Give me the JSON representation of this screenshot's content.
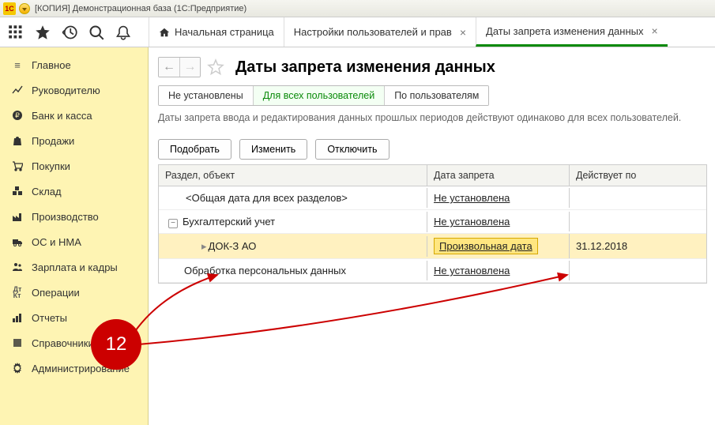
{
  "titlebar": {
    "text": "[КОПИЯ] Демонстрационная база  (1С:Предприятие)",
    "logo": "1С"
  },
  "toolbar_icons": [
    "apps",
    "star",
    "history",
    "search",
    "bell"
  ],
  "tabs": [
    {
      "label": "Начальная страница",
      "home": true,
      "closable": false
    },
    {
      "label": "Настройки пользователей и прав",
      "closable": true
    },
    {
      "label": "Даты запрета изменения данных",
      "closable": true,
      "active": true
    }
  ],
  "sidebar": [
    {
      "icon": "menu",
      "label": "Главное"
    },
    {
      "icon": "trend",
      "label": "Руководителю"
    },
    {
      "icon": "ruble",
      "label": "Банк и касса"
    },
    {
      "icon": "bag",
      "label": "Продажи"
    },
    {
      "icon": "cart",
      "label": "Покупки"
    },
    {
      "icon": "boxes",
      "label": "Склад"
    },
    {
      "icon": "factory",
      "label": "Производство"
    },
    {
      "icon": "truck",
      "label": "ОС и НМА"
    },
    {
      "icon": "people",
      "label": "Зарплата и кадры"
    },
    {
      "icon": "dtkt",
      "label": "Операции"
    },
    {
      "icon": "bars",
      "label": "Отчеты"
    },
    {
      "icon": "book",
      "label": "Справочники"
    },
    {
      "icon": "gear",
      "label": "Администрирование"
    }
  ],
  "page": {
    "title": "Даты запрета изменения данных",
    "segments": [
      "Не установлены",
      "Для всех пользователей",
      "По пользователям"
    ],
    "active_segment": 1,
    "hint": "Даты запрета ввода и редактирования данных прошлых периодов действуют одинаково для всех пользователей.",
    "buttons": [
      "Подобрать",
      "Изменить",
      "Отключить"
    ],
    "columns": [
      "Раздел, объект",
      "Дата запрета",
      "Действует по"
    ],
    "rows": [
      {
        "c1": "<Общая дата для всех разделов>",
        "c2": "Не установлена",
        "c3": "",
        "indent": 1
      },
      {
        "c1": "Бухгалтерский учет",
        "c2": "Не установлена",
        "c3": "",
        "indent": 0,
        "expander": "-"
      },
      {
        "c1": "ДОК-З АО",
        "c2": "Произвольная дата",
        "c3": "31.12.2018",
        "indent": 2,
        "selected": true
      },
      {
        "c1": "Обработка персональных данных",
        "c2": "Не установлена",
        "c3": "",
        "indent": 0
      }
    ]
  },
  "annotation": {
    "label": "12"
  }
}
